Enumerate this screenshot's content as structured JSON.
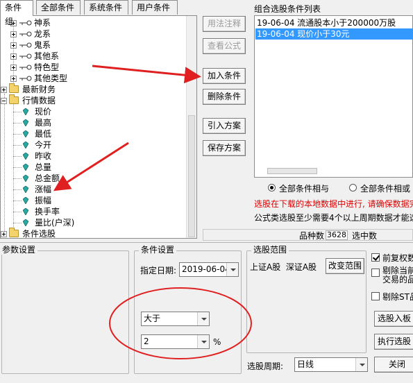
{
  "tabs": [
    "条件组",
    "全部条件",
    "系统条件",
    "用户条件"
  ],
  "tree": {
    "categories": [
      "神系",
      "龙系",
      "鬼系",
      "其他系",
      "特色型",
      "其他类型"
    ],
    "finance": "最新财务",
    "market": "行情数据",
    "market_items": [
      "现价",
      "最高",
      "最低",
      "今开",
      "昨收",
      "总量",
      "总金额",
      "涨幅",
      "振幅",
      "换手率",
      "量比(户深)"
    ],
    "selection": "条件选股"
  },
  "buttons": {
    "usage": "用法注释",
    "view_formula": "查看公式",
    "add": "加入条件",
    "delete": "删除条件",
    "import": "引入方案",
    "save": "保存方案"
  },
  "conditions": {
    "title": "组合选股条件列表",
    "items": [
      "19-06-04 流通股本小于200000万股",
      "19-06-04 现价小于30元"
    ]
  },
  "logic": {
    "and_label": "全部条件相与",
    "or_label": "全部条件相或"
  },
  "notes": {
    "line1": "选股在下载的本地数据中进行, 请确保数据完",
    "line2": "公式类选股至少需要4个以上周期数据才能选"
  },
  "stats": {
    "count_label": "品种数",
    "count_value": "3628",
    "selected_label": "选中数"
  },
  "params": {
    "title": "参数设置"
  },
  "condition_settings": {
    "title": "条件设置",
    "date_label": "指定日期:",
    "date_value": "2019-06-04",
    "operator": "大于",
    "value": "2",
    "unit": "%"
  },
  "range": {
    "title": "选股范围",
    "markets": "上证A股  深证A股",
    "change_button": "改变范围",
    "period_label": "选股周期:",
    "period_value": "日线"
  },
  "options": {
    "restore_rights": "前复权数",
    "exclude_current_1": "剔除当前",
    "exclude_current_2": "交易的品",
    "exclude_st": "剔除ST品",
    "to_block": "选股入板",
    "execute": "执行选股",
    "close": "关闭"
  },
  "colors": {
    "accent": "#3399ff",
    "warning": "#e00000",
    "annotation": "#e02020"
  }
}
